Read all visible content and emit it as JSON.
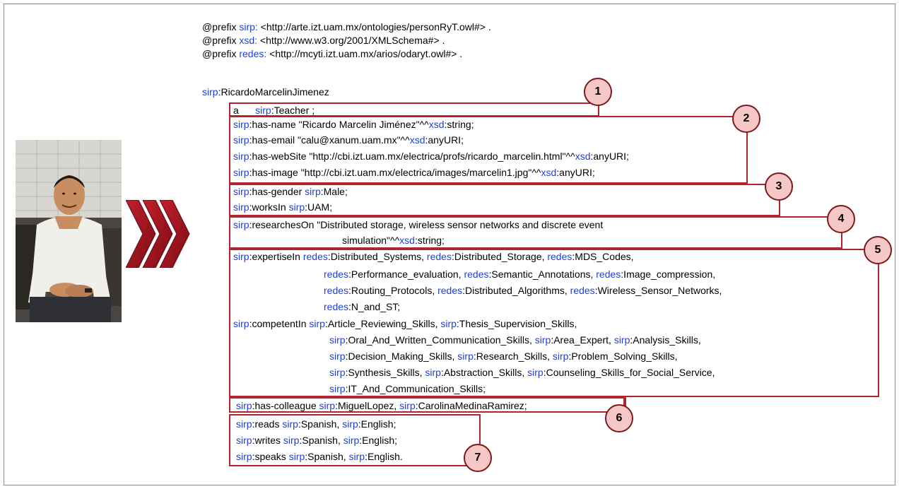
{
  "colors": {
    "prefix_blue": "#1f3fd8",
    "box_red": "#b32430",
    "badge_fill": "#f5c7c7",
    "arrow_red": "#a0121e"
  },
  "photo": {
    "icon": "person-photo",
    "description_hint": "man seated wearing white t-shirt"
  },
  "badges": [
    "1",
    "2",
    "3",
    "4",
    "5",
    "6",
    "7"
  ],
  "lines": [
    [
      [
        "",
        "@prefix "
      ],
      [
        "p",
        "sirp:"
      ],
      [
        "",
        " <http://arte.izt.uam.mx/ontologies/personRyT.owl#> ."
      ]
    ],
    [
      [
        "",
        "@prefix "
      ],
      [
        "p",
        "xsd:"
      ],
      [
        "",
        " <http://www.w3.org/2001/XMLSchema#> ."
      ]
    ],
    [
      [
        "",
        "@prefix "
      ],
      [
        "p",
        "redes:"
      ],
      [
        "",
        " <http://mcyti.izt.uam.mx/arios/odaryt.owl#> ."
      ]
    ],
    [
      [
        "p",
        "sirp"
      ],
      [
        "",
        ":RicardoMarcelinJimenez"
      ]
    ],
    [
      [
        "",
        "a      "
      ],
      [
        "p",
        "sirp"
      ],
      [
        "",
        ":Teacher ;"
      ]
    ],
    [
      [
        "p",
        "sirp"
      ],
      [
        "",
        ":has-name \"Ricardo Marcelin Jiménez\"^^"
      ],
      [
        "p",
        "xsd"
      ],
      [
        "",
        ":string;"
      ]
    ],
    [
      [
        "p",
        "sirp"
      ],
      [
        "",
        ":has-email \"calu@xanum.uam.mx\"^^"
      ],
      [
        "p",
        "xsd"
      ],
      [
        "",
        ":anyURI;"
      ]
    ],
    [
      [
        "p",
        "sirp"
      ],
      [
        "",
        ":has-webSite \"http://cbi.izt.uam.mx/electrica/profs/ricardo_marcelin.html\"^^"
      ],
      [
        "p",
        "xsd"
      ],
      [
        "",
        ":anyURI;"
      ]
    ],
    [
      [
        "p",
        "sirp"
      ],
      [
        "",
        ":has-image \"http://cbi.izt.uam.mx/electrica/images/marcelin1.jpg\"^^"
      ],
      [
        "p",
        "xsd"
      ],
      [
        "",
        ":anyURI;"
      ]
    ],
    [
      [
        "p",
        "sirp"
      ],
      [
        "",
        ":has-gender "
      ],
      [
        "p",
        "sirp"
      ],
      [
        "",
        ":Male;"
      ]
    ],
    [
      [
        "p",
        "sirp"
      ],
      [
        "",
        ":worksIn "
      ],
      [
        "p",
        "sirp"
      ],
      [
        "",
        ":UAM;"
      ]
    ],
    [
      [
        "p",
        "sirp"
      ],
      [
        "",
        ":researchesOn \"Distributed storage, wireless sensor networks and discrete event"
      ]
    ],
    [
      [
        "",
        "simulation\"^^"
      ],
      [
        "p",
        "xsd"
      ],
      [
        "",
        ":string;"
      ]
    ],
    [
      [
        "p",
        "sirp"
      ],
      [
        "",
        ":expertiseIn "
      ],
      [
        "p",
        "redes"
      ],
      [
        "",
        ":Distributed_Systems, "
      ],
      [
        "p",
        "redes"
      ],
      [
        "",
        ":Distributed_Storage, "
      ],
      [
        "p",
        "redes"
      ],
      [
        "",
        ":MDS_Codes,"
      ]
    ],
    [
      [
        "p",
        "redes"
      ],
      [
        "",
        ":Performance_evaluation, "
      ],
      [
        "p",
        "redes"
      ],
      [
        "",
        ":Semantic_Annotations, "
      ],
      [
        "p",
        "redes"
      ],
      [
        "",
        ":Image_compression,"
      ]
    ],
    [
      [
        "p",
        "redes"
      ],
      [
        "",
        ":Routing_Protocols, "
      ],
      [
        "p",
        "redes"
      ],
      [
        "",
        ":Distributed_Algorithms, "
      ],
      [
        "p",
        "redes"
      ],
      [
        "",
        ":Wireless_Sensor_Networks,"
      ]
    ],
    [
      [
        "p",
        "redes"
      ],
      [
        "",
        ":N_and_ST;"
      ]
    ],
    [
      [
        "p",
        "sirp"
      ],
      [
        "",
        ":competentIn "
      ],
      [
        "p",
        "sirp"
      ],
      [
        "",
        ":Article_Reviewing_Skills, "
      ],
      [
        "p",
        "sirp"
      ],
      [
        "",
        ":Thesis_Supervision_Skills,"
      ]
    ],
    [
      [
        "p",
        "sirp"
      ],
      [
        "",
        ":Oral_And_Written_Communication_Skills, "
      ],
      [
        "p",
        "sirp"
      ],
      [
        "",
        ":Area_Expert, "
      ],
      [
        "p",
        "sirp"
      ],
      [
        "",
        ":Analysis_Skills,"
      ]
    ],
    [
      [
        "p",
        "sirp"
      ],
      [
        "",
        ":Decision_Making_Skills, "
      ],
      [
        "p",
        "sirp"
      ],
      [
        "",
        ":Research_Skills, "
      ],
      [
        "p",
        "sirp"
      ],
      [
        "",
        ":Problem_Solving_Skills,"
      ]
    ],
    [
      [
        "p",
        "sirp"
      ],
      [
        "",
        ":Synthesis_Skills, "
      ],
      [
        "p",
        "sirp"
      ],
      [
        "",
        ":Abstraction_Skills, "
      ],
      [
        "p",
        "sirp"
      ],
      [
        "",
        ":Counseling_Skills_for_Social_Service,"
      ]
    ],
    [
      [
        "p",
        "sirp"
      ],
      [
        "",
        ":IT_And_Communication_Skills;"
      ]
    ],
    [
      [
        "p",
        "sirp"
      ],
      [
        "",
        ":has-colleague "
      ],
      [
        "p",
        "sirp"
      ],
      [
        "",
        ":MiguelLopez, "
      ],
      [
        "p",
        "sirp"
      ],
      [
        "",
        ":CarolinaMedinaRamirez;"
      ]
    ],
    [
      [
        "p",
        "sirp"
      ],
      [
        "",
        ":reads "
      ],
      [
        "p",
        "sirp"
      ],
      [
        "",
        ":Spanish, "
      ],
      [
        "p",
        "sirp"
      ],
      [
        "",
        ":English;"
      ]
    ],
    [
      [
        "p",
        "sirp"
      ],
      [
        "",
        ":writes "
      ],
      [
        "p",
        "sirp"
      ],
      [
        "",
        ":Spanish, "
      ],
      [
        "p",
        "sirp"
      ],
      [
        "",
        ":English;"
      ]
    ],
    [
      [
        "p",
        "sirp"
      ],
      [
        "",
        ":speaks "
      ],
      [
        "p",
        "sirp"
      ],
      [
        "",
        ":Spanish, "
      ],
      [
        "p",
        "sirp"
      ],
      [
        "",
        ":English."
      ]
    ]
  ]
}
